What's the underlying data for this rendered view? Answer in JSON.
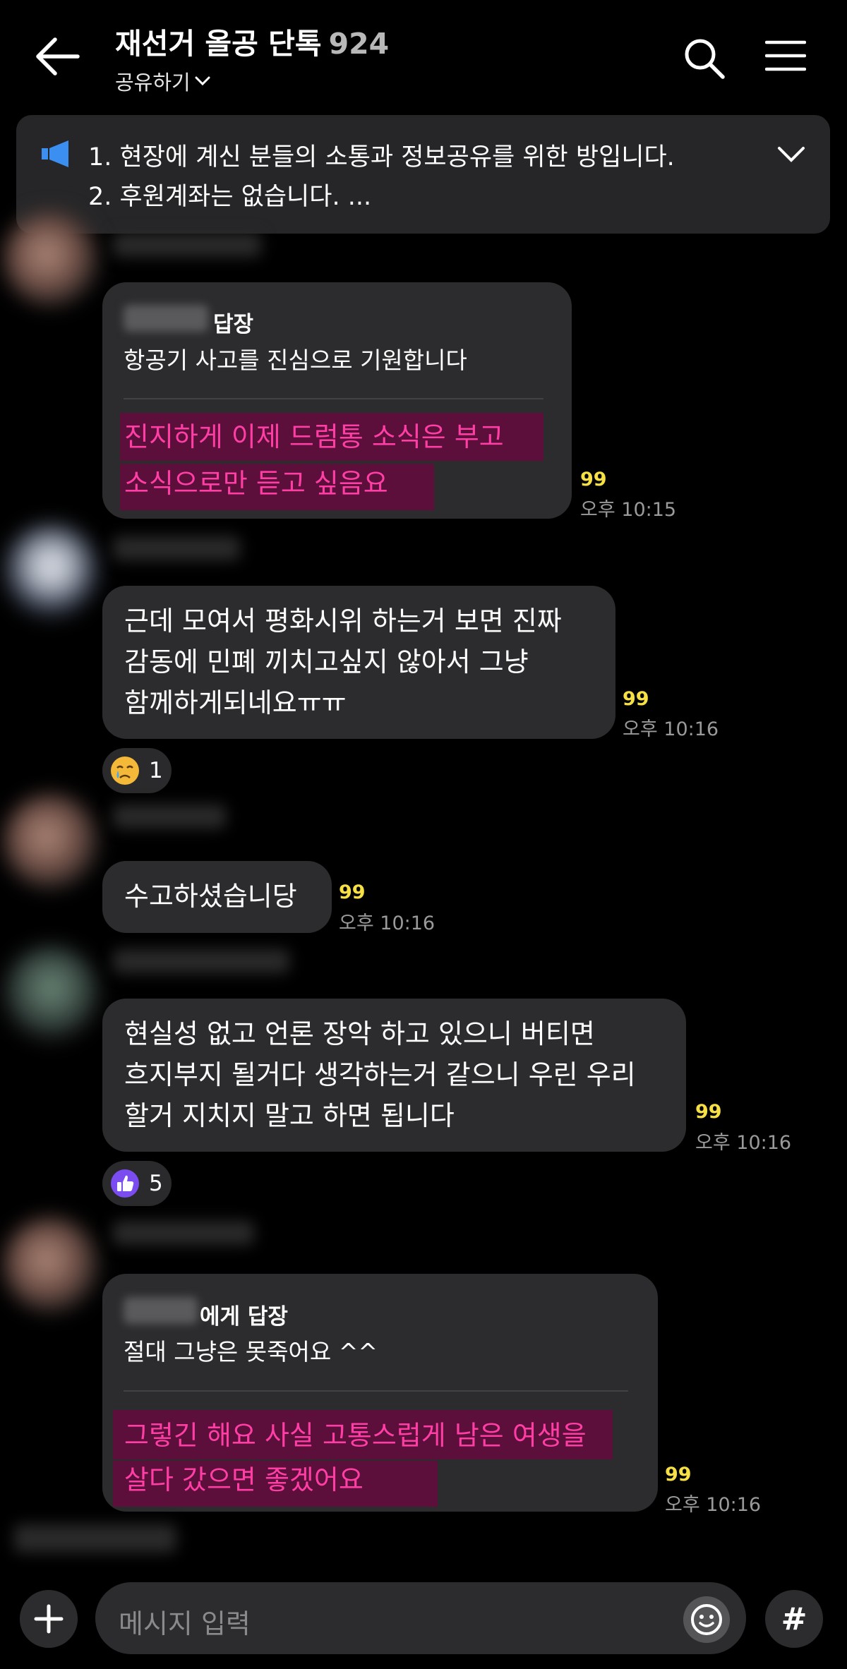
{
  "header": {
    "title": "재선거 올공 단톡",
    "member_count": "924",
    "share_label": "공유하기"
  },
  "notice": {
    "line1": "1. 현장에 계신 분들의 소통과 정보공유를 위한 방입니다.",
    "line2": "2. 후원계좌는 없습니다.  ..."
  },
  "messages": [
    {
      "reply_label": "답장",
      "reply_quote": "항공기 사고를 진심으로 기원합니다",
      "lines": [
        "진지하게 이제 드럼통 소식은 부고",
        "소식으로만 듣고 싶음요"
      ],
      "unread": "99",
      "time": "오후 10:15"
    },
    {
      "lines": [
        "근데 모여서 평화시위 하는거 보면 진짜",
        "감동에 민폐 끼치고싶지 않아서 그냥",
        "함께하게되네요ㅠㅠ"
      ],
      "unread": "99",
      "time": "오후 10:16",
      "reaction": {
        "icon": "crying-face-icon",
        "count": "1"
      }
    },
    {
      "lines": [
        "수고하셨습니당"
      ],
      "unread": "99",
      "time": "오후 10:16"
    },
    {
      "lines": [
        "현실성 없고 언론 장악 하고 있으니 버티면",
        "흐지부지 될거다 생각하는거 같으니 우린 우리",
        "할거 지치지 말고 하면 됩니다"
      ],
      "unread": "99",
      "time": "오후 10:16",
      "reaction": {
        "icon": "thumbs-up-icon",
        "count": "5"
      }
    },
    {
      "reply_label": "에게 답장",
      "reply_quote": "절대 그냥은 못죽어요 ^^",
      "lines": [
        "그렇긴 해요 사실 고통스럽게 남은 여생을",
        "살다 갔으면 좋겠어요"
      ],
      "unread": "99",
      "time": "오후 10:16"
    }
  ],
  "input": {
    "placeholder": "메시지 입력",
    "hash_label": "#"
  },
  "colors": {
    "background": "#000000",
    "bubble": "#2c2c2e",
    "unread": "#f7e045",
    "highlight_text": "#ff3ea5",
    "highlight_bg": "#5b0f3a",
    "notice_icon": "#3b8ff0",
    "thumbs_up": "#7b4cf0"
  }
}
